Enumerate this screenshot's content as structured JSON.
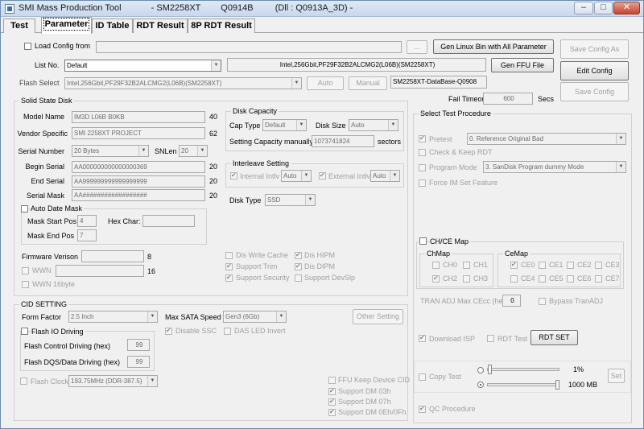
{
  "window": {
    "title": "SMI Mass Production Tool",
    "controller": "- SM2258XT",
    "version": "Q0914B",
    "dll": "(Dll : Q0913A_3D) -",
    "min_glyph": "–",
    "max_glyph": "□",
    "close_glyph": "✕"
  },
  "tabs": [
    "Test",
    "Parameter",
    "ID Table",
    "RDT Result",
    "8P RDT Result"
  ],
  "top": {
    "load_config_label": "Load Config from",
    "load_config_path": "",
    "browse_label": "...",
    "gen_linux_bin_label": "Gen Linux Bin with All Parameter",
    "save_config_as_label": "Save Config As",
    "list_no_label": "List No.",
    "list_no_value": "Default",
    "flash_desc": "Intel,256Gbit,PF29F32B2ALCMG2(L06B)(SM2258XT)",
    "gen_ffu_label": "Gen FFU File",
    "edit_config_label": "Edit Config",
    "flash_select_label": "Flash Select",
    "flash_select_value": "Intel,256Gbit,PF29F32B2ALCMG2(L06B)(SM2258XT)",
    "auto_label": "Auto",
    "manual_label": "Manual",
    "database_label": "SM2258XT-DataBase-Q0908",
    "save_config_label": "Save Config",
    "fail_timeout_label": "Fail Timeout",
    "fail_timeout_value": "600",
    "secs_label": "Secs"
  },
  "ssd": {
    "group_title": "Solid State Disk",
    "model_name_label": "Model Name",
    "model_name_value": "IM3D L06B B0KB",
    "model_name_len": "40",
    "vendor_label": "Vendor Specific",
    "vendor_value": "SMI 2258XT PROJECT",
    "vendor_len": "62",
    "serial_number_label": "Serial Number",
    "serial_number_value": "20 Bytes",
    "snlen_label": "SNLen",
    "snlen_value": "20",
    "begin_serial_label": "Begin Serial",
    "begin_serial_value": "AA000000000000000369",
    "begin_serial_len": "20",
    "end_serial_label": "End Serial",
    "end_serial_value": "AA999999999999999999",
    "end_serial_len": "20",
    "serial_mask_label": "Serial Mask",
    "serial_mask_value": "AA##################",
    "serial_mask_len": "20",
    "auto_date_mask_label": "Auto Date Mask",
    "mask_start_label": "Mask Start Pos",
    "mask_start_value": "4",
    "hex_char_label": "Hex Char:",
    "hex_char_value": "",
    "mask_end_label": "Mask End Pos",
    "mask_end_value": "7",
    "firmware_label": "Firmware Verison",
    "firmware_value": "",
    "firmware_len": "8",
    "wwn_label": "WWN",
    "wwn_value": "",
    "wwn_len": "16",
    "wwn16_label": "WWN 16byte"
  },
  "disk_capacity": {
    "group_title": "Disk Capacity",
    "cap_type_label": "Cap Type",
    "cap_type_value": "Default",
    "disk_size_label": "Disk Size",
    "disk_size_value": "Auto",
    "setting_cap_label": "Setting Capacity manually",
    "setting_cap_value": "1073741824",
    "sectors_label": "sectors"
  },
  "interleave": {
    "group_title": "Interleave Setting",
    "internal_label": "Internal Intlv",
    "internal_value": "Auto",
    "external_label": "External Intlv",
    "external_value": "Auto"
  },
  "disk_type": {
    "label": "Disk Type",
    "value": "SSD"
  },
  "features": {
    "dis_write_cache": "Dis Write Cache",
    "dis_hipm": "Dis HIPM",
    "support_trim": "Support Trim",
    "dis_dipm": "Dis DIPM",
    "support_security": "Support Security",
    "support_devslp": "Support DevSlp"
  },
  "cid": {
    "group_title": "CID SETTING",
    "form_factor_label": "Form Factor",
    "form_factor_value": "2.5 Inch",
    "max_sata_label": "Max SATA Speed",
    "max_sata_value": "Gen3 (6Gb)",
    "other_setting_label": "Other Setting",
    "flash_io_label": "Flash IO Driving",
    "disable_ssc_label": "Disable SSC",
    "das_led_label": "DAS LED Invert",
    "flash_control_label": "Flash Control Driving (hex)",
    "flash_control_value": "99",
    "flash_dqs_label": "Flash DQS/Data Driving (hex)",
    "flash_dqs_value": "99",
    "flash_clock_label": "Flash Clock",
    "flash_clock_value": "193.75MHz (DDR-387.5)",
    "ffu_keep_label": "FFU Keep Device CID",
    "support_dm03_label": "Support DM 03h",
    "support_dm07_label": "Support DM 07h",
    "support_dm0e_label": "Support DM 0Eh/0Fh"
  },
  "test_procedure": {
    "group_title": "Select Test Procedure",
    "pretest_label": "Pretest",
    "pretest_value": "0. Reference Original Bad",
    "check_keep_rdt_label": "Check & Keep RDT",
    "program_mode_label": "Program Mode",
    "program_mode_value": "3. SanDisk Program dummy Mode",
    "force_im_label": "Force IM Set Feature",
    "chce_map_label": "CH/CE Map",
    "chmap_title": "ChMap",
    "cemap_title": "CeMap",
    "ch_labels": [
      "CH0",
      "CH1",
      "CH2",
      "CH3"
    ],
    "ce_labels": [
      "CE0",
      "CE1",
      "CE2",
      "CE3",
      "CE4",
      "CE5",
      "CE6",
      "CE7"
    ],
    "tran_adj_label": "TRAN ADJ Max CEcc (hex)",
    "tran_adj_value": "0",
    "bypass_tranadj_label": "Bypass TranADJ",
    "download_isp_label": "Download ISP",
    "rdt_test_label": "RDT Test",
    "rdt_set_label": "RDT SET",
    "copy_test_label": "Copy Test",
    "copy_pct_label": "1%",
    "copy_pct_value": 0.01,
    "copy_mb_label": "1000 MB",
    "copy_mb_value": 1,
    "set_label": "Set",
    "qc_label": "QC Procedure"
  }
}
